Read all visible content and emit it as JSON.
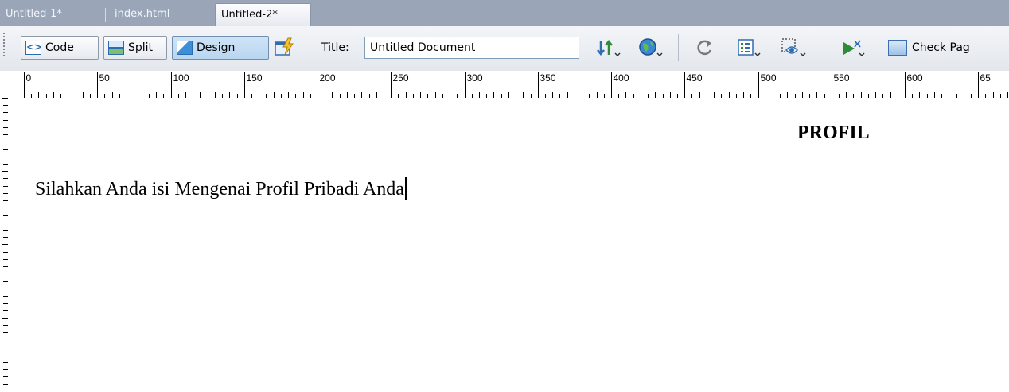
{
  "tabs": [
    {
      "label": "Untitled-1*",
      "active": false
    },
    {
      "label": "index.html",
      "active": false
    },
    {
      "label": "Untitled-2*",
      "active": true
    }
  ],
  "toolbar": {
    "code_label": "Code",
    "split_label": "Split",
    "design_label": "Design",
    "title_label": "Title:",
    "title_value": "Untitled Document",
    "check_page_label": "Check Pag",
    "active_view": "Design"
  },
  "ruler": {
    "labels": [
      "0",
      "50",
      "100",
      "150",
      "200",
      "250",
      "300",
      "350",
      "400",
      "450",
      "500",
      "550",
      "600",
      "65"
    ]
  },
  "document": {
    "heading": "PROFIL",
    "paragraph": "Silahkan Anda isi Mengenai Profil Pribadi Anda"
  },
  "colors": {
    "tabbar_bg": "#9aa6b8",
    "pressed_button": "#b9d6f0"
  }
}
